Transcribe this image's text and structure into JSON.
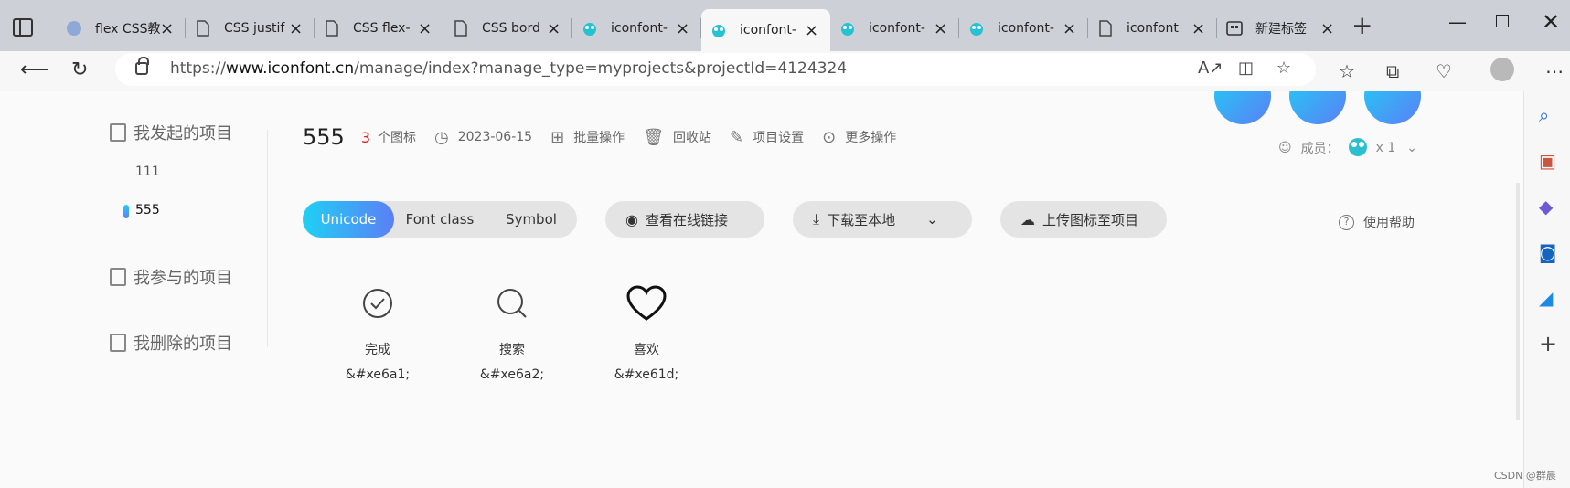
{
  "browser": {
    "tabs": [
      {
        "title": "flex CSS教",
        "icon": "globe-icon"
      },
      {
        "title": "CSS justif",
        "icon": "page-icon"
      },
      {
        "title": "CSS flex-",
        "icon": "page-icon"
      },
      {
        "title": "CSS bord",
        "icon": "page-icon"
      },
      {
        "title": "iconfont-",
        "icon": "iconfont-logo-icon"
      },
      {
        "title": "iconfont-",
        "icon": "iconfont-logo-icon",
        "active": true
      },
      {
        "title": "iconfont-",
        "icon": "iconfont-logo-icon"
      },
      {
        "title": "iconfont-",
        "icon": "iconfont-logo-icon"
      },
      {
        "title": "iconfont",
        "icon": "page-icon"
      },
      {
        "title": "新建标签",
        "icon": "new-tab-icon"
      }
    ],
    "url_prefix": "https://",
    "url_host": "www.iconfont.cn",
    "url_path": "/manage/index?manage_type=myprojects&projectId=4124324"
  },
  "sidebar": {
    "section_mine": "我发起的项目",
    "projects": [
      "111",
      "555"
    ],
    "active_project": "555",
    "section_joined": "我参与的项目",
    "section_deleted": "我删除的项目"
  },
  "project": {
    "name": "555",
    "count": "3",
    "count_label": "个图标",
    "date": "2023-06-15",
    "batch": "批量操作",
    "recycle": "回收站",
    "settings": "项目设置",
    "more": "更多操作",
    "members_label": "成员：",
    "members_count": "x 1"
  },
  "toolbar": {
    "modes": [
      "Unicode",
      "Font class",
      "Symbol"
    ],
    "active_mode": "Unicode",
    "view_link": "查看在线链接",
    "download": "下载至本地",
    "upload": "上传图标至项目",
    "help": "使用帮助"
  },
  "icons": [
    {
      "name": "完成",
      "code": "&#xe6a1;",
      "glyph": "check-circle-icon"
    },
    {
      "name": "搜索",
      "code": "&#xe6a2;",
      "glyph": "search-icon"
    },
    {
      "name": "喜欢",
      "code": "&#xe61d;",
      "glyph": "heart-icon"
    }
  ],
  "watermark": "CSDN @群晨",
  "colors": {
    "accent_start": "#1fd0f4",
    "accent_end": "#5b7ff6",
    "count_red": "#e41d1d"
  }
}
